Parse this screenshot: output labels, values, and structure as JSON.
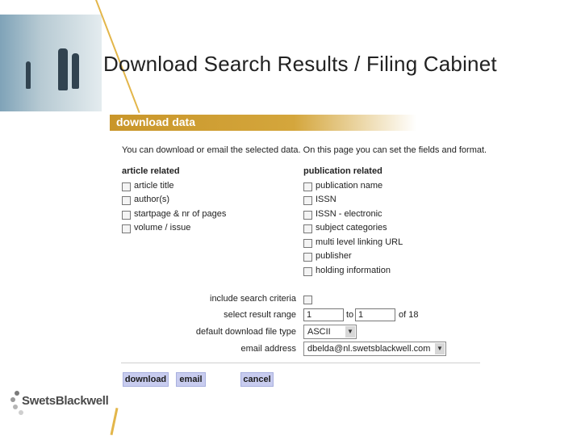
{
  "slide": {
    "title": "Download Search Results / Filing Cabinet",
    "accent_color": "#e3b64a"
  },
  "panel": {
    "header": "download data",
    "intro": "You can download or email the selected data. On this page you can set the fields and format.",
    "article_related": {
      "heading": "article related",
      "items": [
        "article title",
        "author(s)",
        "startpage & nr of pages",
        "volume / issue"
      ]
    },
    "publication_related": {
      "heading": "publication related",
      "items": [
        "publication name",
        "ISSN",
        "ISSN - electronic",
        "subject categories",
        "multi level linking URL",
        "publisher",
        "holding information"
      ]
    },
    "include_search_criteria_label": "include search criteria",
    "select_result_range_label": "select result range",
    "range_from": "1",
    "range_to_label": "to",
    "range_to": "1",
    "range_of_label": "of 18",
    "file_type_label": "default download file type",
    "file_type_value": "ASCII",
    "email_label": "email address",
    "email_value": "dbelda@nl.swetsblackwell.com",
    "buttons": {
      "download": "download",
      "email": "email",
      "cancel": "cancel"
    }
  },
  "logo": {
    "text": "SwetsBlackwell"
  }
}
